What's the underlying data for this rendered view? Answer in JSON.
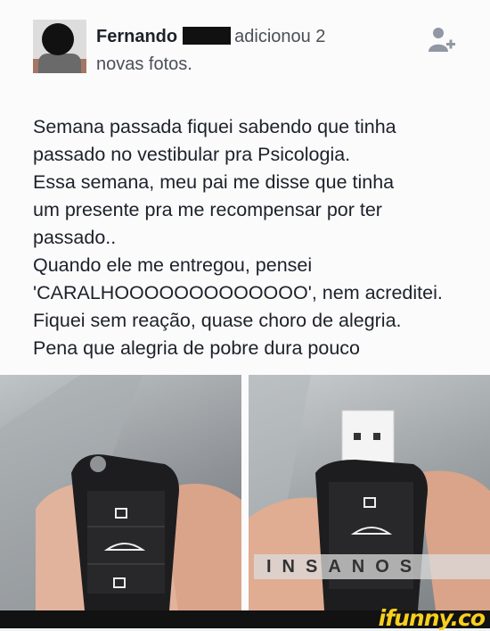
{
  "post": {
    "author_name": "Fernando",
    "action_part1": "adicionou 2",
    "action_part2": "novas fotos.",
    "add_friend_icon": "add-friend-icon",
    "text_lines": [
      "Semana passada fiquei sabendo que tinha",
      "passado no vestibular pra Psicologia.",
      "Essa semana, meu pai me disse que tinha",
      "um presente pra me recompensar por ter",
      "passado..",
      "Quando ele me entregou, pensei",
      "'CARALHOOOOOOOOOOOOO', nem acreditei.",
      "Fiquei sem reação, quase choro de alegria.",
      "Pena que alegria de pobre dura pouco"
    ]
  },
  "photos": {
    "watermark": "INSANOS"
  },
  "footer": {
    "logo": "ifunny.co"
  }
}
